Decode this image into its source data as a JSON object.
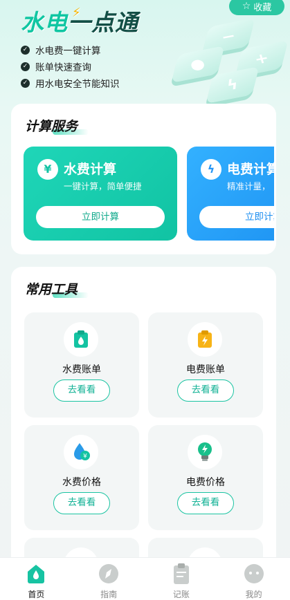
{
  "header": {
    "logo_text_part1": "水电",
    "logo_text_part2": "一点通",
    "favorite_label": "收藏",
    "features": [
      "水电费一键计算",
      "账单快速查询",
      "用水电安全节能知识"
    ]
  },
  "calc_section": {
    "title": "计算服务",
    "cards": [
      {
        "name": "水费计算",
        "desc": "一键计算，简单便捷",
        "button": "立即计算",
        "icon": "water-yuan-icon"
      },
      {
        "name": "电费计算",
        "desc": "精准计量，",
        "button": "立即计算",
        "icon": "bulb-bolt-icon"
      }
    ]
  },
  "tools_section": {
    "title": "常用工具",
    "tools": [
      {
        "name": "水费账单",
        "button": "去看看",
        "icon": "water-bill-icon"
      },
      {
        "name": "电费账单",
        "button": "去看看",
        "icon": "electric-bill-icon"
      },
      {
        "name": "水费价格",
        "button": "去看看",
        "icon": "water-price-icon"
      },
      {
        "name": "电费价格",
        "button": "去看看",
        "icon": "electric-price-icon"
      }
    ]
  },
  "nav": {
    "items": [
      {
        "label": "首页",
        "icon": "home-icon",
        "active": true
      },
      {
        "label": "指南",
        "icon": "compass-icon",
        "active": false
      },
      {
        "label": "记账",
        "icon": "clipboard-icon",
        "active": false
      },
      {
        "label": "我的",
        "icon": "profile-icon",
        "active": false
      }
    ]
  },
  "colors": {
    "primary": "#19c3a1",
    "blue": "#1a8df0",
    "amber": "#f5b400"
  }
}
